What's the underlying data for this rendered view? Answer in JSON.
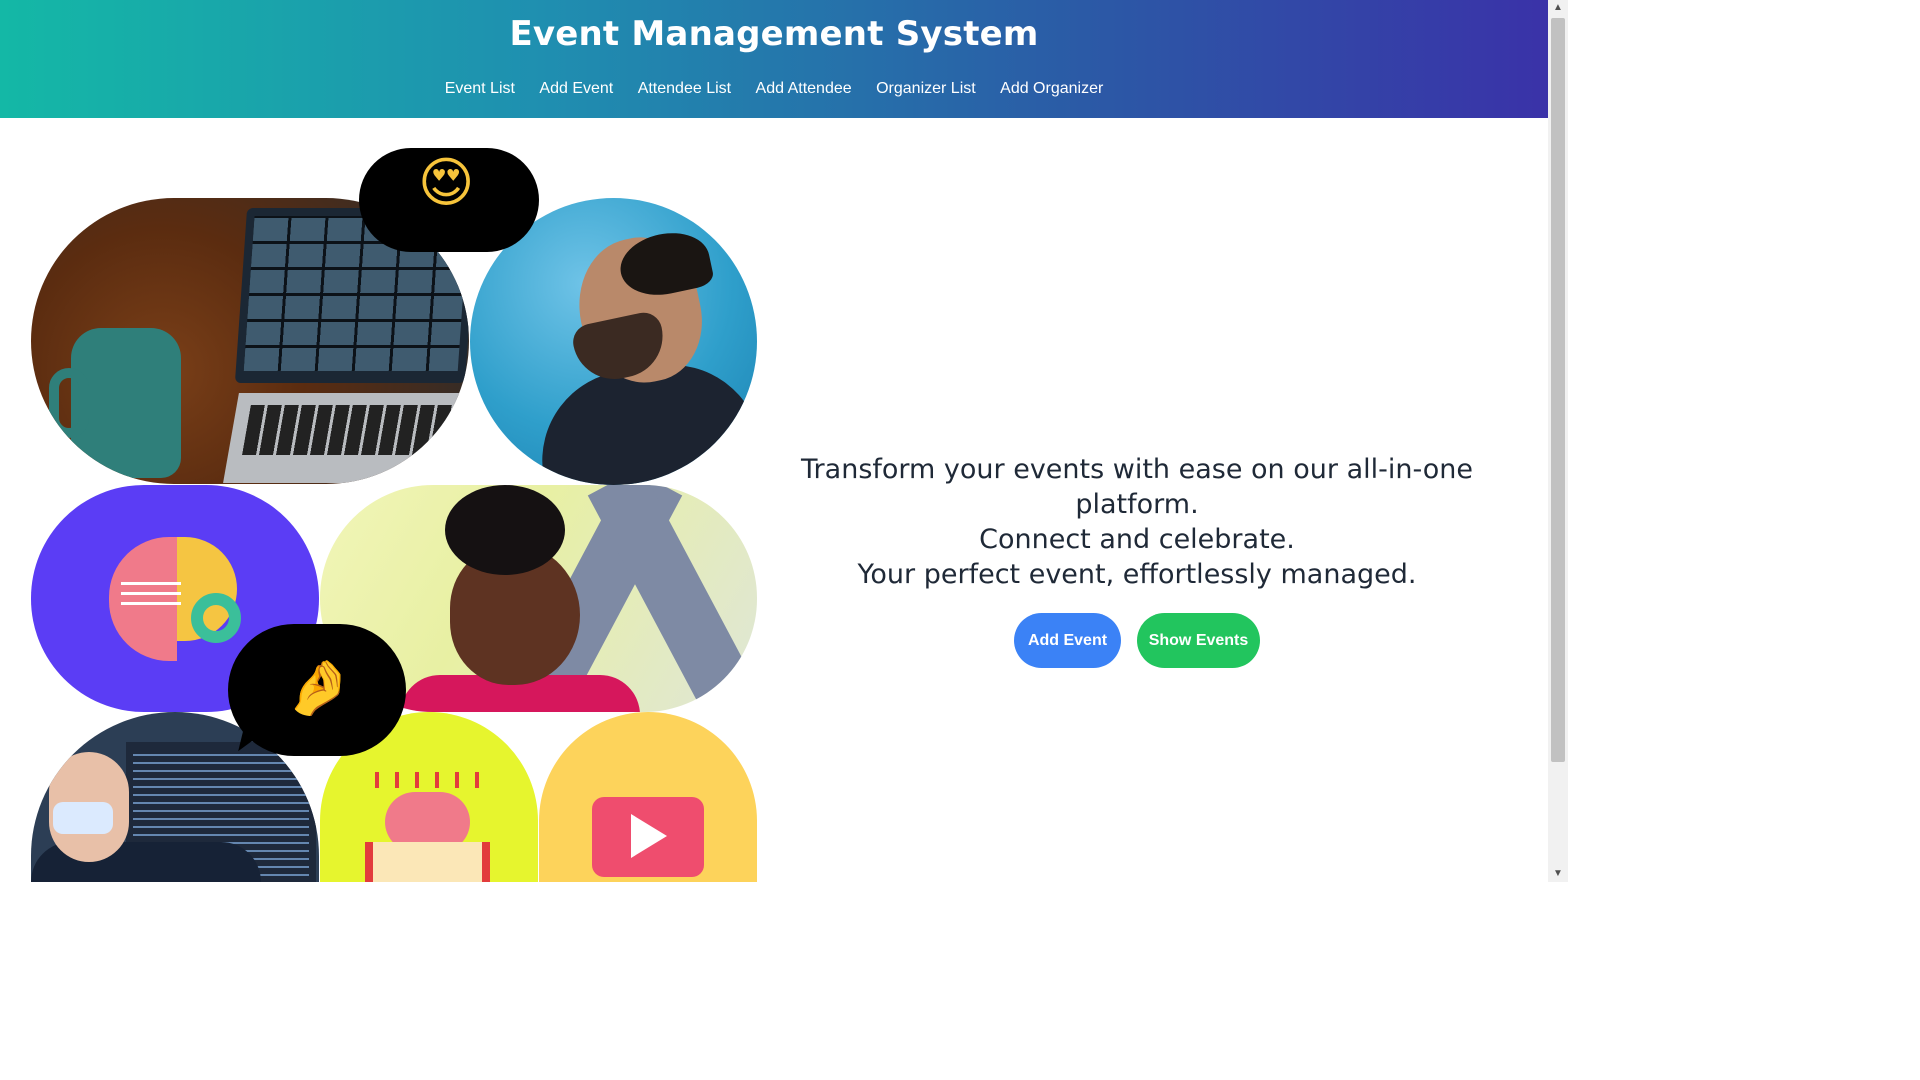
{
  "header": {
    "title": "Event Management System",
    "nav": [
      {
        "label": "Event List"
      },
      {
        "label": "Add Event"
      },
      {
        "label": "Attendee List"
      },
      {
        "label": "Add Attendee"
      },
      {
        "label": "Organizer List"
      },
      {
        "label": "Add Organizer"
      }
    ]
  },
  "hero": {
    "lines": [
      "Transform your events with ease on our all-in-one",
      "platform.",
      "Connect and celebrate.",
      "Your perfect event, effortlessly managed."
    ],
    "add_button": "Add Event",
    "show_button": "Show Events"
  },
  "collage": {
    "emoji_top": "😍",
    "emoji_bottom": "🤌"
  },
  "colors": {
    "header_gradient_start": "#14b8a6",
    "header_gradient_end": "#3a32a8",
    "add_button": "#3b82f6",
    "show_button": "#22c55e"
  }
}
